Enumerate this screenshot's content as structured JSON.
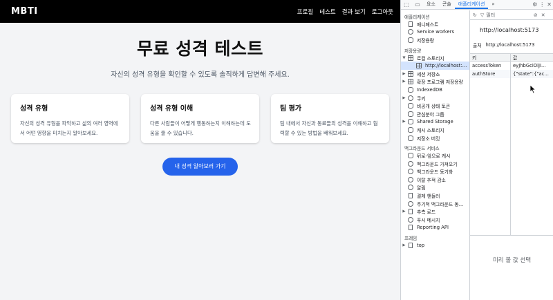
{
  "page": {
    "brand": "MBTI",
    "nav": [
      "프로필",
      "테스트",
      "결과 보기",
      "로그아웃"
    ],
    "title": "무료 성격 테스트",
    "subtitle": "자신의 성격 유형을 확인할 수 있도록 솔직하게 답변해 주세요.",
    "cards": [
      {
        "title": "성격 유형",
        "text": "자신의 성격 유형을 파악하고 삶의 여러 영역에서 어떤 영향을 미치는지 알아보세요."
      },
      {
        "title": "성격 유형 이해",
        "text": "다른 사람들이 어떻게 행동하는지 이해하는데 도움을 줄 수 있습니다."
      },
      {
        "title": "팀 평가",
        "text": "팀 내에서 자신과 동료들의 성격을 이해하고 협력할 수 있는 방법을 배워보세요."
      }
    ],
    "cta": "내 성격 알아보러 가기"
  },
  "devtools": {
    "tabs": [
      "요소",
      "콘솔",
      "애플리케이션"
    ],
    "more": "»",
    "sections": {
      "app": "애플리케이션",
      "storage": "저장용량",
      "background": "백그라운드 서비스",
      "frames": "프레임"
    },
    "app_items": [
      "매니페스트",
      "Service workers",
      "저장용량"
    ],
    "storage_items": [
      {
        "label": "로컬 스토리지",
        "arrow": "▼",
        "icon": "grid"
      },
      {
        "label": "http://localhost:…",
        "arrow": "",
        "icon": "grid",
        "selected": true,
        "indent": true
      },
      {
        "label": "세션 저장소",
        "arrow": "▶",
        "icon": "grid"
      },
      {
        "label": "확장 프로그램 저장용량",
        "arrow": "▶",
        "icon": "grid"
      },
      {
        "label": "IndexedDB",
        "arrow": "",
        "icon": "db"
      },
      {
        "label": "쿠키",
        "arrow": "▶",
        "icon": "circle"
      },
      {
        "label": "비공개 상태 토큰",
        "arrow": "",
        "icon": "db"
      },
      {
        "label": "관심분야 그룹",
        "arrow": "",
        "icon": "db"
      },
      {
        "label": "Shared Storage",
        "arrow": "▶",
        "icon": "db"
      },
      {
        "label": "캐시 스토리지",
        "arrow": "",
        "icon": "db"
      },
      {
        "label": "저장소 버킷",
        "arrow": "",
        "icon": "db"
      }
    ],
    "bg_items": [
      {
        "label": "뒤로-앞으로 캐시",
        "arrow": "",
        "icon": "db"
      },
      {
        "label": "백그라운드 가져오기",
        "arrow": "",
        "icon": "circle"
      },
      {
        "label": "백그라운드 동기화",
        "arrow": "",
        "icon": "circle"
      },
      {
        "label": "이탈 추적 감소",
        "arrow": "",
        "icon": "circle"
      },
      {
        "label": "알림",
        "arrow": "",
        "icon": "circle"
      },
      {
        "label": "결제 핸들러",
        "arrow": "",
        "icon": "doc"
      },
      {
        "label": "주기적 백그라운드 동…",
        "arrow": "",
        "icon": "circle"
      },
      {
        "label": "추측 로드",
        "arrow": "▶",
        "icon": "doc"
      },
      {
        "label": "푸시 메시지",
        "arrow": "",
        "icon": "circle"
      },
      {
        "label": "Reporting API",
        "arrow": "",
        "icon": "doc"
      }
    ],
    "frames_items": [
      {
        "label": "top",
        "arrow": "▶",
        "icon": "doc"
      }
    ],
    "filter_placeholder": "필터",
    "origin_url": "http://localhost:5173",
    "origin_label": "출처",
    "origin_value": "http://localhost:5173",
    "table": {
      "key_header": "키",
      "value_header": "값",
      "rows": [
        {
          "key": "accessToken",
          "value": "eyJhbGciOiJI..."
        },
        {
          "key": "authStore",
          "value": "{\"state\":{\"ac..."
        }
      ]
    },
    "preview": "미리 볼 값 선택"
  }
}
